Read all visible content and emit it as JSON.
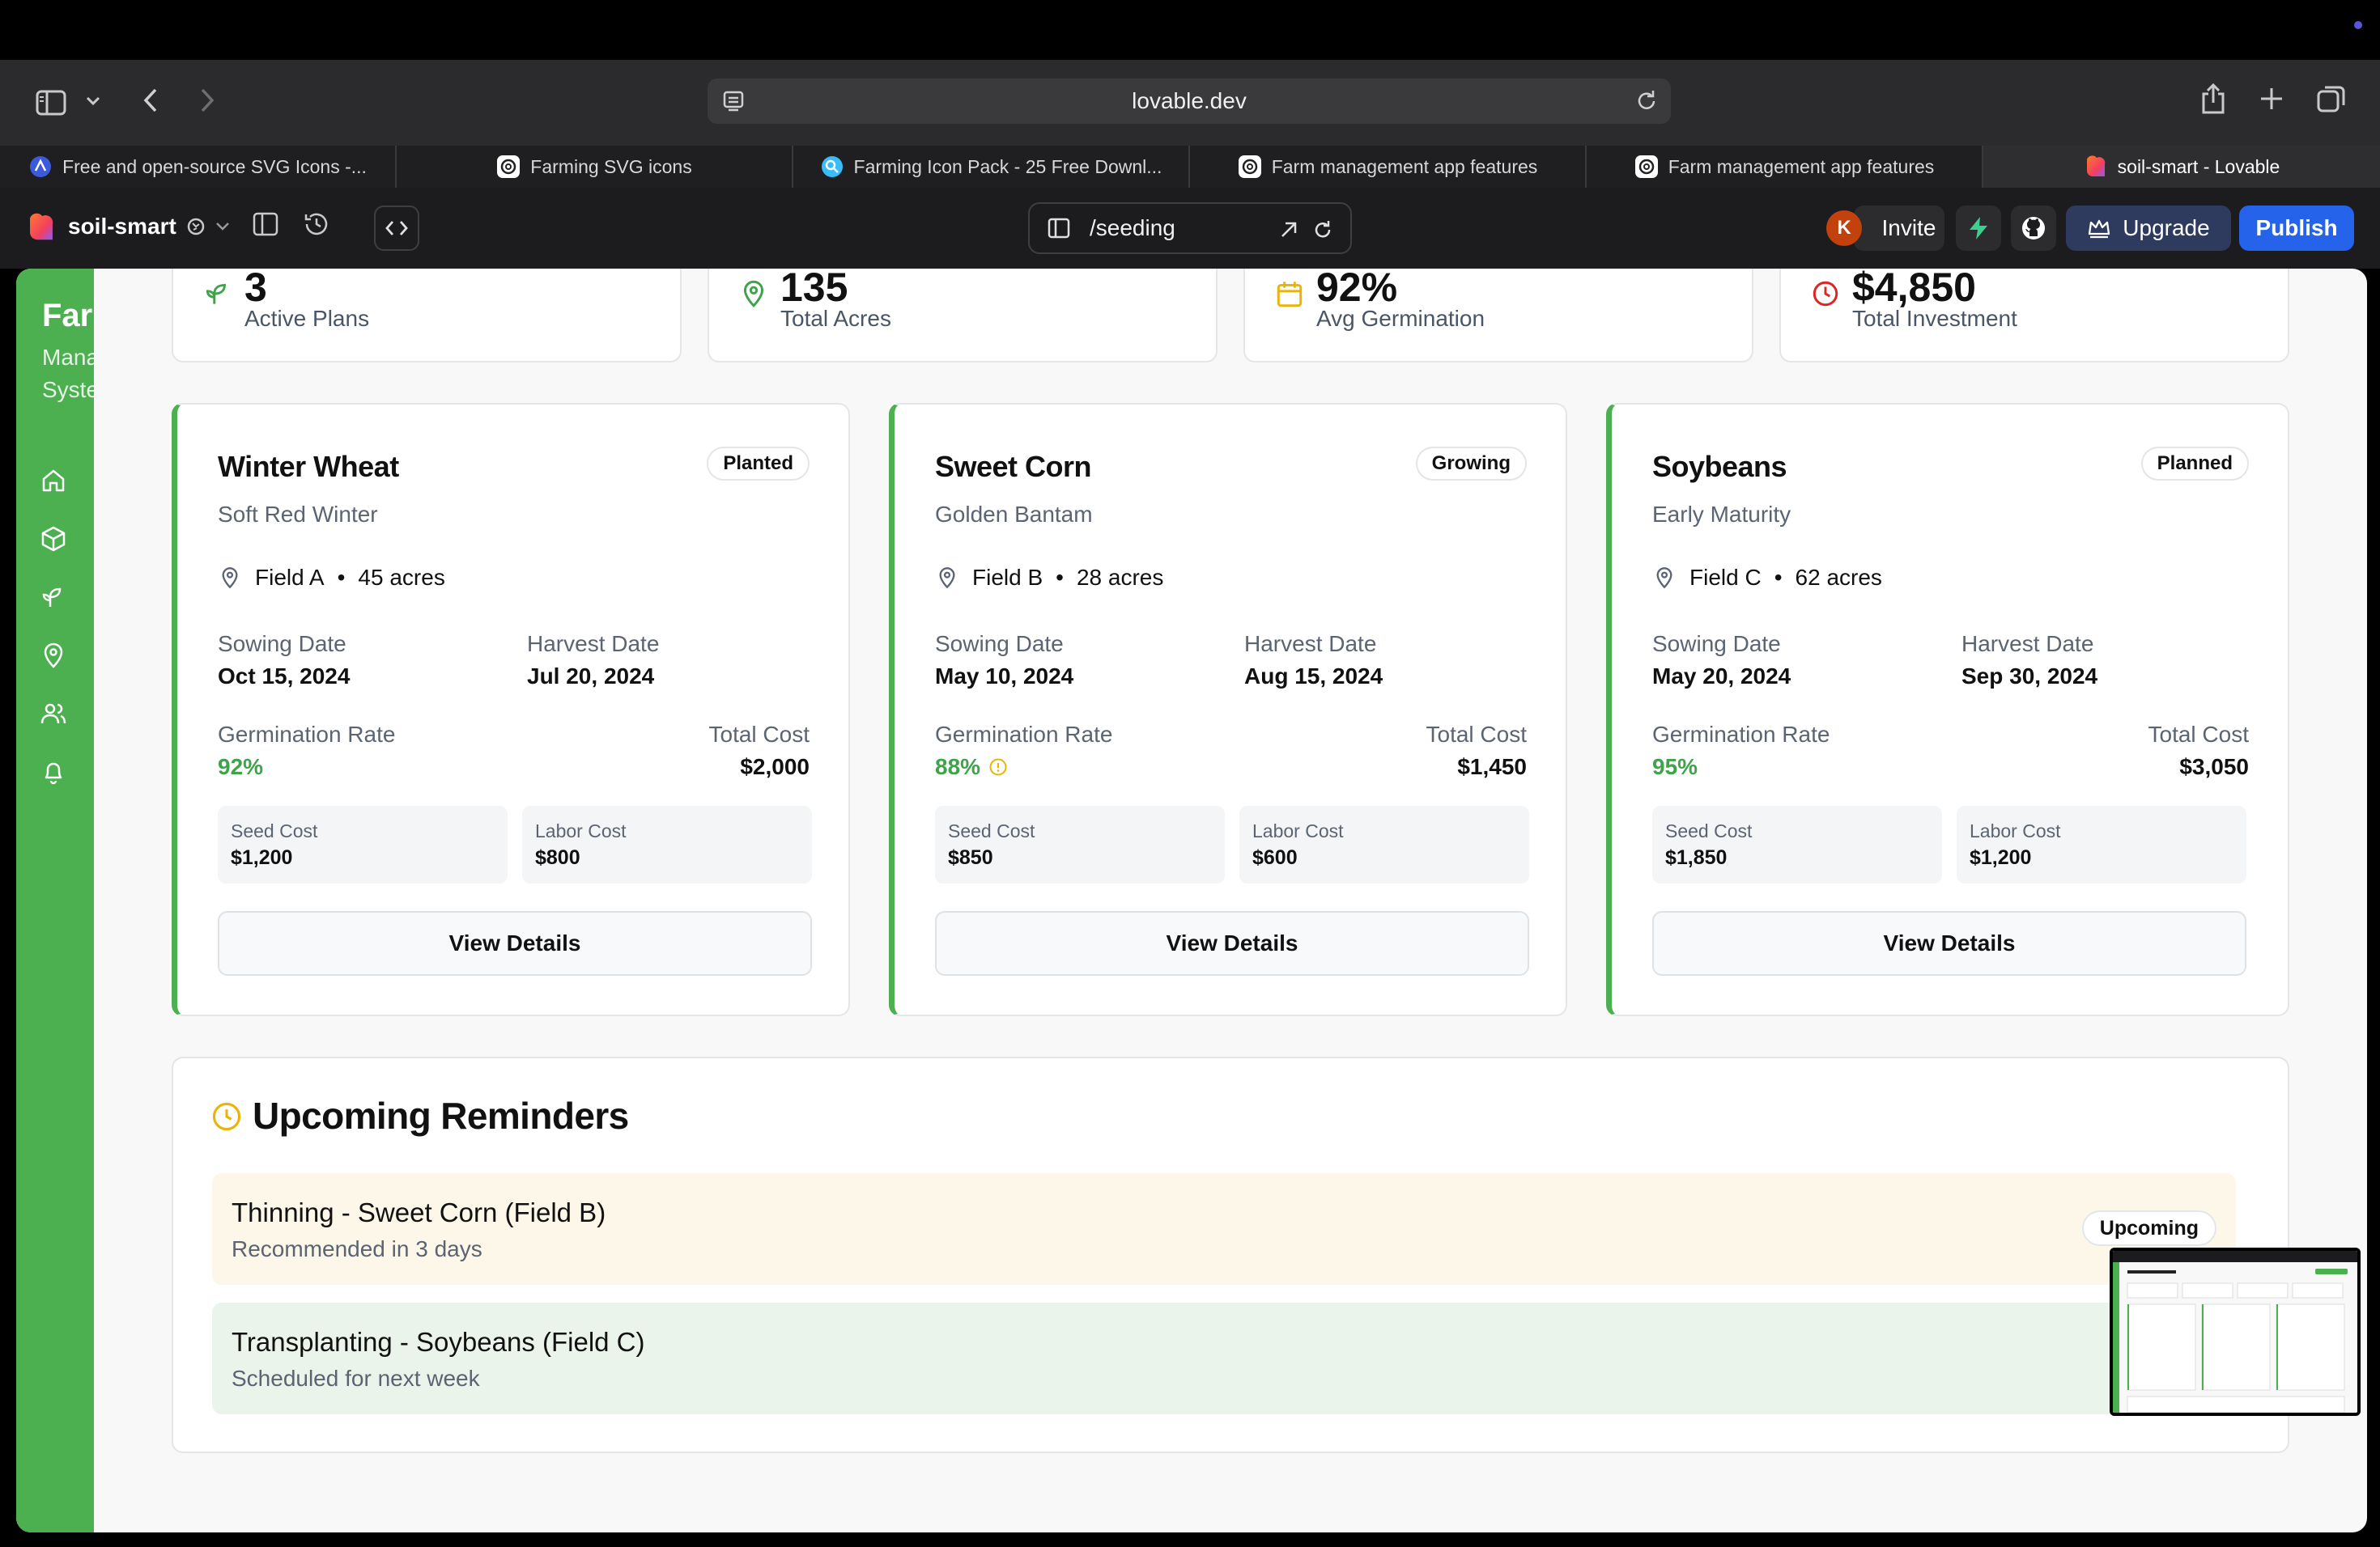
{
  "browser": {
    "url": "lovable.dev",
    "tabs": [
      {
        "label": "Free and open-source SVG Icons -...",
        "icon": "globe-blue-icon"
      },
      {
        "label": "Farming SVG icons",
        "icon": "openai-icon"
      },
      {
        "label": "Farming Icon Pack - 25 Free Downl...",
        "icon": "search-blue-icon"
      },
      {
        "label": "Farm management app features",
        "icon": "openai-icon"
      },
      {
        "label": "Farm management app features",
        "icon": "openai-icon"
      },
      {
        "label": "soil-smart - Lovable",
        "icon": "lovable-heart-icon"
      }
    ]
  },
  "appbar": {
    "project": "soil-smart",
    "route": "/seeding",
    "avatar_initial": "K",
    "invite": "Invite",
    "upgrade": "Upgrade",
    "publish": "Publish",
    "publish_color": "#2563eb",
    "brand_color": "#4caf50"
  },
  "sidebar": {
    "title": "Farm",
    "subtitle_1": "Management",
    "subtitle_2": "System",
    "items": [
      "home-icon",
      "package-icon",
      "sprout-icon",
      "map-pin-icon",
      "users-icon",
      "bell-icon"
    ]
  },
  "stats": [
    {
      "value": "3",
      "label": "Active Plans",
      "icon": "sprout-icon",
      "color": "#3ea44a"
    },
    {
      "value": "135",
      "label": "Total Acres",
      "icon": "map-pin-icon",
      "color": "#3ea44a"
    },
    {
      "value": "92%",
      "label": "Avg Germination",
      "icon": "calendar-icon",
      "color": "#eab308"
    },
    {
      "value": "$4,850",
      "label": "Total Investment",
      "icon": "clock-icon",
      "color": "#dc2626"
    }
  ],
  "crops": [
    {
      "name": "Winter Wheat",
      "status": "Planted",
      "variety": "Soft Red Winter",
      "field": "Field A",
      "acres": "45 acres",
      "sowing_label": "Sowing Date",
      "sowing": "Oct 15, 2024",
      "harvest_label": "Harvest Date",
      "harvest": "Jul 20, 2024",
      "germ_label": "Germination Rate",
      "germ": "92%",
      "total_label": "Total Cost",
      "total": "$2,000",
      "seed_label": "Seed Cost",
      "seed": "$1,200",
      "labor_label": "Labor Cost",
      "labor": "$800",
      "button": "View Details"
    },
    {
      "name": "Sweet Corn",
      "status": "Growing",
      "variety": "Golden Bantam",
      "field": "Field B",
      "acres": "28 acres",
      "sowing_label": "Sowing Date",
      "sowing": "May 10, 2024",
      "harvest_label": "Harvest Date",
      "harvest": "Aug 15, 2024",
      "germ_label": "Germination Rate",
      "germ": "88%",
      "total_label": "Total Cost",
      "total": "$1,450",
      "seed_label": "Seed Cost",
      "seed": "$850",
      "labor_label": "Labor Cost",
      "labor": "$600",
      "button": "View Details"
    },
    {
      "name": "Soybeans",
      "status": "Planned",
      "variety": "Early Maturity",
      "field": "Field C",
      "acres": "62 acres",
      "sowing_label": "Sowing Date",
      "sowing": "May 20, 2024",
      "harvest_label": "Harvest Date",
      "harvest": "Sep 30, 2024",
      "germ_label": "Germination Rate",
      "germ": "95%",
      "total_label": "Total Cost",
      "total": "$3,050",
      "seed_label": "Seed Cost",
      "seed": "$1,850",
      "labor_label": "Labor Cost",
      "labor": "$1,200",
      "button": "View Details"
    }
  ],
  "reminders": {
    "title": "Upcoming Reminders",
    "items": [
      {
        "name": "Thinning - Sweet Corn (Field B)",
        "sub": "Recommended in 3 days",
        "badge": "Upcoming",
        "bg": "#fdf7ea"
      },
      {
        "name": "Transplanting - Soybeans (Field C)",
        "sub": "Scheduled for next week",
        "badge": "",
        "bg": "#ebf4ea"
      }
    ]
  },
  "separator": "•"
}
